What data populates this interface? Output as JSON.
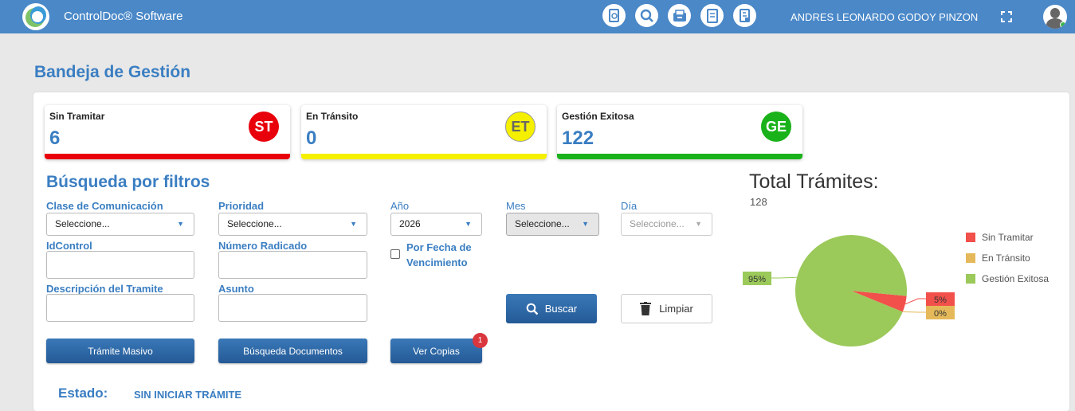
{
  "app": {
    "title": "ControlDoc® Software",
    "user_name": "ANDRES LEONARDO GODOY PINZON",
    "nav_icons": [
      "document-search-icon",
      "search-icon",
      "inbox-icon",
      "form-icon",
      "report-icon"
    ]
  },
  "page": {
    "title": "Bandeja de Gestión"
  },
  "cards": [
    {
      "label": "Sin Tramitar",
      "value": "6",
      "badge": "ST",
      "color": "#e8000b",
      "badge_text_color": "#ffffff"
    },
    {
      "label": "En Tránsito",
      "value": "0",
      "badge": "ET",
      "color": "#f5f000",
      "badge_text_color": "#555555"
    },
    {
      "label": "Gestión Exitosa",
      "value": "122",
      "badge": "GE",
      "color": "#1ab21a",
      "badge_text_color": "#ffffff"
    }
  ],
  "filters": {
    "title": "Búsqueda por filtros",
    "clase_label": "Clase de Comunicación",
    "clase_value": "Seleccione...",
    "prioridad_label": "Prioridad",
    "prioridad_value": "Seleccione...",
    "anio_label": "Año",
    "anio_value": "2026",
    "mes_label": "Mes",
    "mes_value": "Seleccione...",
    "dia_label": "Día",
    "dia_value": "Seleccione...",
    "idcontrol_label": "IdControl",
    "numero_label": "Número Radicado",
    "vencimiento_label": "Por Fecha de Vencimiento",
    "descripcion_label": "Descripción del Tramite",
    "asunto_label": "Asunto"
  },
  "buttons": {
    "buscar": "Buscar",
    "limpiar": "Limpiar",
    "masivo": "Trámite Masivo",
    "documentos": "Búsqueda Documentos",
    "copias": "Ver Copias",
    "copias_badge": "1"
  },
  "chart_data": {
    "type": "pie",
    "title": "Total Trámites:",
    "total": "128",
    "categories": [
      "Sin Tramitar",
      "En Tránsito",
      "Gestión Exitosa"
    ],
    "values": [
      6,
      0,
      122
    ],
    "data_labels": [
      "5%",
      "0%",
      "95%"
    ],
    "colors": [
      "#f2504b",
      "#e5b95a",
      "#9bc95a"
    ],
    "legend_position": "right"
  },
  "estado": {
    "label": "Estado:",
    "value": "SIN INICIAR TRÁMITE"
  }
}
